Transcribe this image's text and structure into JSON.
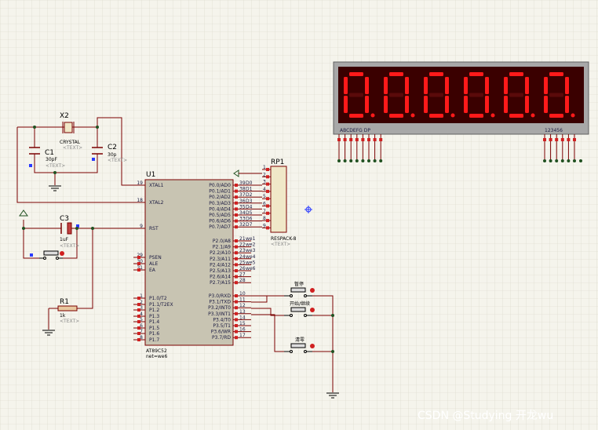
{
  "components": {
    "x2": {
      "ref": "X2",
      "value": "CRYSTAL",
      "text": "<TEXT>"
    },
    "c1": {
      "ref": "C1",
      "value": "30pF",
      "text": "<TEXT>"
    },
    "c2": {
      "ref": "C2",
      "value": "30p",
      "text": "<TEXT>"
    },
    "c3": {
      "ref": "C3",
      "value": "1uF",
      "text": "<TEXT>"
    },
    "r1": {
      "ref": "R1",
      "value": "1k",
      "text": "<TEXT>"
    },
    "rp1": {
      "ref": "RP1",
      "value": "RESPACK-8",
      "text": "<TEXT>",
      "pins": [
        "1",
        "2",
        "3",
        "4",
        "5",
        "6",
        "7",
        "8",
        "9"
      ]
    },
    "u1": {
      "ref": "U1",
      "chip": "AT89C52",
      "net": "net=we6"
    }
  },
  "mcu": {
    "left_pins": [
      {
        "num": "19",
        "name": "XTAL1"
      },
      {
        "num": "18",
        "name": "XTAL2"
      },
      {
        "num": "9",
        "name": "RST"
      },
      {
        "num": "29",
        "name": "PSEN"
      },
      {
        "num": "30",
        "name": "ALE"
      },
      {
        "num": "31",
        "name": "EA"
      },
      {
        "num": "1",
        "name": "P1.0/T2"
      },
      {
        "num": "2",
        "name": "P1.1/T2EX"
      },
      {
        "num": "3",
        "name": "P1.2"
      },
      {
        "num": "4",
        "name": "P1.3"
      },
      {
        "num": "5",
        "name": "P1.4"
      },
      {
        "num": "6",
        "name": "P1.5"
      },
      {
        "num": "7",
        "name": "P1.6"
      },
      {
        "num": "8",
        "name": "P1.7"
      }
    ],
    "p0_pins": [
      {
        "num": "39",
        "name": "P0.0/AD0",
        "net": "D0"
      },
      {
        "num": "38",
        "name": "P0.1/AD1",
        "net": "D1"
      },
      {
        "num": "37",
        "name": "P0.2/AD2",
        "net": "D2"
      },
      {
        "num": "36",
        "name": "P0.3/AD3",
        "net": "D3"
      },
      {
        "num": "35",
        "name": "P0.4/AD4",
        "net": "D4"
      },
      {
        "num": "34",
        "name": "P0.5/AD5",
        "net": "D5"
      },
      {
        "num": "33",
        "name": "P0.6/AD6",
        "net": "D6"
      },
      {
        "num": "32",
        "name": "P0.7/AD7",
        "net": "D7"
      }
    ],
    "p2_pins": [
      {
        "num": "21",
        "name": "P2.0/A8",
        "net": "we1"
      },
      {
        "num": "22",
        "name": "P2.1/A9",
        "net": "we2"
      },
      {
        "num": "23",
        "name": "P2.2/A10",
        "net": "we3"
      },
      {
        "num": "24",
        "name": "P2.3/A11",
        "net": "we4"
      },
      {
        "num": "25",
        "name": "P2.4/A12",
        "net": "we5"
      },
      {
        "num": "26",
        "name": "P2.5/A13",
        "net": "we6"
      },
      {
        "num": "27",
        "name": "P2.6/A14",
        "net": ""
      },
      {
        "num": "28",
        "name": "P2.7/A15",
        "net": ""
      }
    ],
    "p3_pins": [
      {
        "num": "10",
        "name": "P3.0/RXD"
      },
      {
        "num": "11",
        "name": "P3.1/TXD"
      },
      {
        "num": "12",
        "name": "P3.2/INT0"
      },
      {
        "num": "13",
        "name": "P3.3/INT1"
      },
      {
        "num": "14",
        "name": "P3.4/T0"
      },
      {
        "num": "15",
        "name": "P3.5/T1"
      },
      {
        "num": "16",
        "name": "P3.6/WR"
      },
      {
        "num": "17",
        "name": "P3.7/RD"
      }
    ]
  },
  "buttons": {
    "pause": "暂停",
    "start": "开始/继续",
    "clear": "清零"
  },
  "display": {
    "digits": [
      "0",
      "0",
      "0",
      "0",
      "0",
      "0"
    ],
    "segment_labels": "ABCDEFG DP",
    "digit_labels": "123456",
    "segment_color": "#ff1a1a",
    "background_color": "#3a0000"
  },
  "watermark": "CSDN @Studying 开龙wu"
}
